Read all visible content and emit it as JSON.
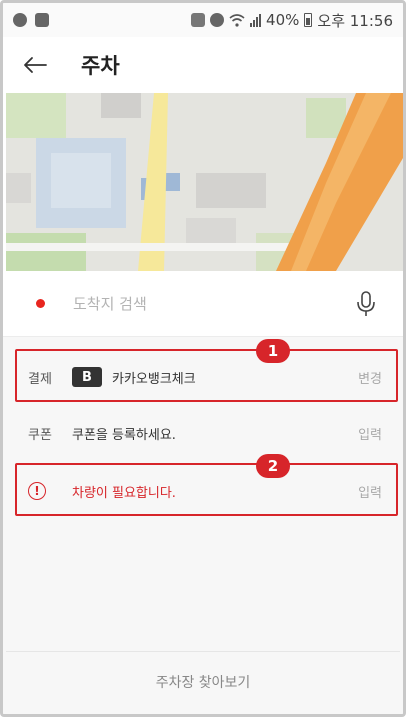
{
  "status_bar": {
    "battery": "40%",
    "time": "오후 11:56",
    "left_icons": [
      "usb-notification-icon",
      "image-notification-icon"
    ],
    "right_icons": [
      "mobile-data-icon",
      "alarm-icon",
      "wifi-icon",
      "signal-icon",
      "battery-icon"
    ]
  },
  "header": {
    "title": "주차",
    "back_icon": "arrow-left-icon"
  },
  "search": {
    "placeholder": "도착지 검색",
    "value": "",
    "mic_icon": "microphone-icon"
  },
  "payment": {
    "label": "결제",
    "bank_logo_text": "B",
    "card_name": "카카오뱅크체크",
    "action": "변경",
    "badge": "1"
  },
  "coupon": {
    "label": "쿠폰",
    "text": "쿠폰을 등록하세요.",
    "action": "입력"
  },
  "vehicle": {
    "icon_glyph": "!",
    "text": "차량이 필요합니다.",
    "action": "입력",
    "badge": "2"
  },
  "footer": {
    "label": "주차장 찾아보기"
  },
  "colors": {
    "accent_red": "#d7252a",
    "dot_red": "#e8251f",
    "bank_logo_bg": "#333333"
  }
}
